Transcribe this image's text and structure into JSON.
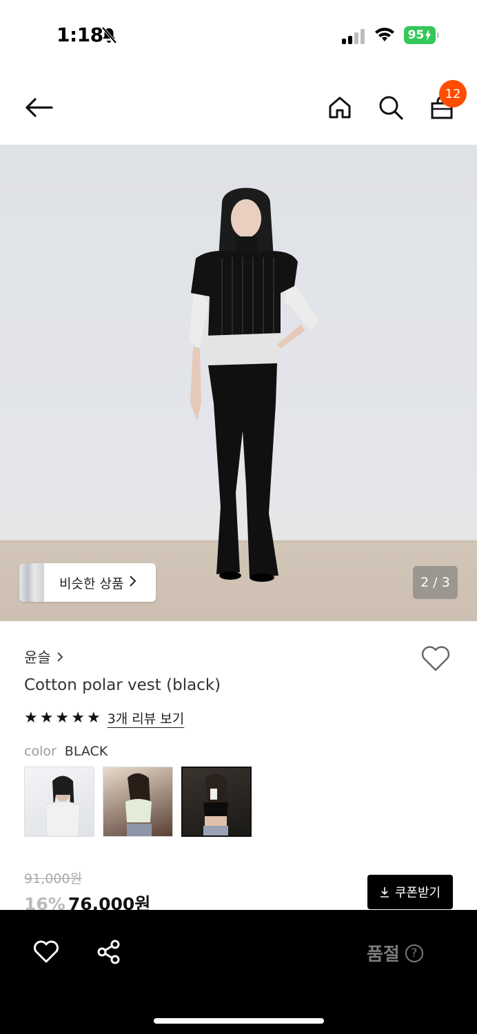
{
  "status": {
    "time": "1:18",
    "battery": "95"
  },
  "nav": {
    "cart_count": "12"
  },
  "hero": {
    "similar_label": "비슷한 상품",
    "page_indicator": "2 / 3"
  },
  "product": {
    "brand": "윤슬",
    "name": "Cotton polar vest (black)",
    "rating_stars": 5,
    "review_link": "3개 리뷰 보기",
    "color_label": "color",
    "color_value": "BLACK",
    "original_price": "91,000원",
    "discount": "16%",
    "sale_price": "76,000원",
    "coupon_label": "쿠폰받기"
  },
  "bottom": {
    "soldout_label": "품절",
    "help_mark": "?"
  },
  "colors": {
    "badge": "#ff4d00",
    "battery": "#34c759",
    "bottom_bar": "#000000"
  }
}
